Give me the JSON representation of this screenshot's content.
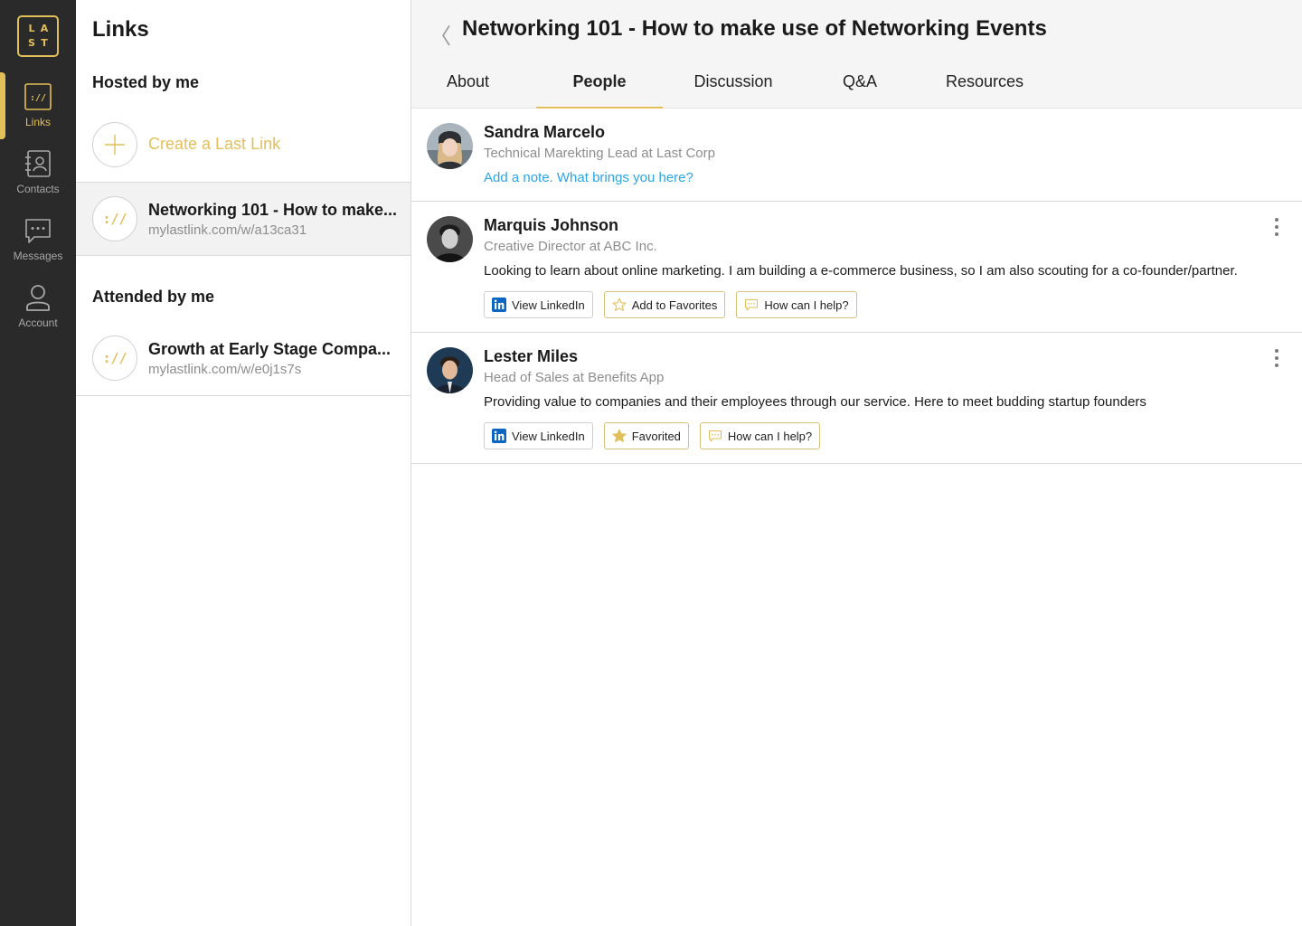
{
  "logo": {
    "letters": [
      "L",
      "A",
      "S",
      "T"
    ]
  },
  "nav": [
    {
      "label": "Links",
      "icon": "links-icon",
      "active": true
    },
    {
      "label": "Contacts",
      "icon": "contacts-icon",
      "active": false
    },
    {
      "label": "Messages",
      "icon": "messages-icon",
      "active": false
    },
    {
      "label": "Account",
      "icon": "account-icon",
      "active": false
    }
  ],
  "panel": {
    "title": "Links",
    "hosted_heading": "Hosted by me",
    "create_label": "Create a Last Link",
    "hosted": [
      {
        "title": "Networking 101 - How to make...",
        "url": "mylastlink.com/w/a13ca31",
        "glyph": "://"
      }
    ],
    "attended_heading": "Attended by me",
    "attended": [
      {
        "title": "Growth at Early Stage Compa...",
        "url": "mylastlink.com/w/e0j1s7s",
        "glyph": "://"
      }
    ]
  },
  "main": {
    "back_glyph": "〈",
    "title": "Networking 101 - How to make use of Networking Events",
    "tabs": [
      {
        "label": "About",
        "active": false
      },
      {
        "label": "People",
        "active": true
      },
      {
        "label": "Discussion",
        "active": false
      },
      {
        "label": "Q&A",
        "active": false
      },
      {
        "label": "Resources",
        "active": false
      }
    ],
    "people": [
      {
        "name": "Sandra Marcelo",
        "role": "Technical Marekting Lead at Last Corp",
        "note": "Add a note. What brings you here?"
      },
      {
        "name": "Marquis Johnson",
        "role": "Creative Director at ABC Inc.",
        "bio": "Looking to learn about online marketing. I am building a e-commerce business, so I am also scouting for a co-founder/partner.",
        "linkedin": "View LinkedIn",
        "favorite": "Add to Favorites",
        "help": "How can I help?"
      },
      {
        "name": "Lester Miles",
        "role": "Head of Sales at Benefits App",
        "bio": "Providing value to companies and their employees through our service. Here to meet budding startup founders",
        "linkedin": "View LinkedIn",
        "favorite": "Favorited",
        "help": "How can I help?"
      }
    ]
  },
  "colors": {
    "accent": "#e3bf5a",
    "rail": "#2a2a2a",
    "link_blue": "#2aa5e8",
    "linkedin": "#0a66c2"
  }
}
